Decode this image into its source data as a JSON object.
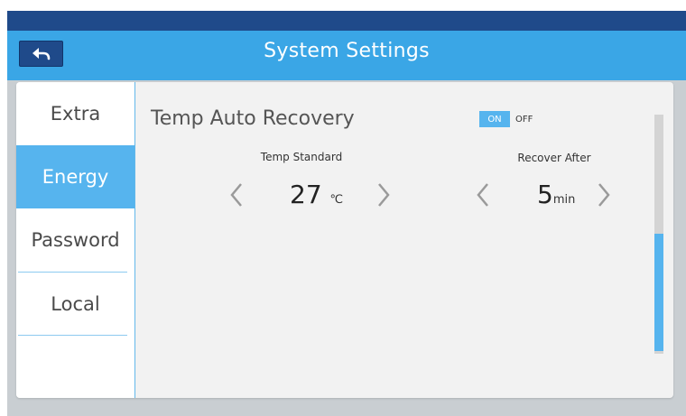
{
  "header": {
    "title": "System Settings",
    "back_icon": "back-arrow-icon"
  },
  "sidebar": {
    "items": [
      {
        "label": "Extra",
        "active": false
      },
      {
        "label": "Energy",
        "active": true
      },
      {
        "label": "Password",
        "active": false
      },
      {
        "label": "Local",
        "active": false
      }
    ]
  },
  "main": {
    "section_title": "Temp Auto Recovery",
    "toggle": {
      "on_label": "ON",
      "off_label": "OFF",
      "state": "on"
    },
    "temp_standard": {
      "label": "Temp Standard",
      "value": "27",
      "unit": "℃"
    },
    "recover_after": {
      "label": "Recover After",
      "value": "5",
      "unit": "min"
    }
  },
  "colors": {
    "accent": "#3aa6e6",
    "active_item": "#56b4ee",
    "top_bar": "#1f4a8a"
  }
}
